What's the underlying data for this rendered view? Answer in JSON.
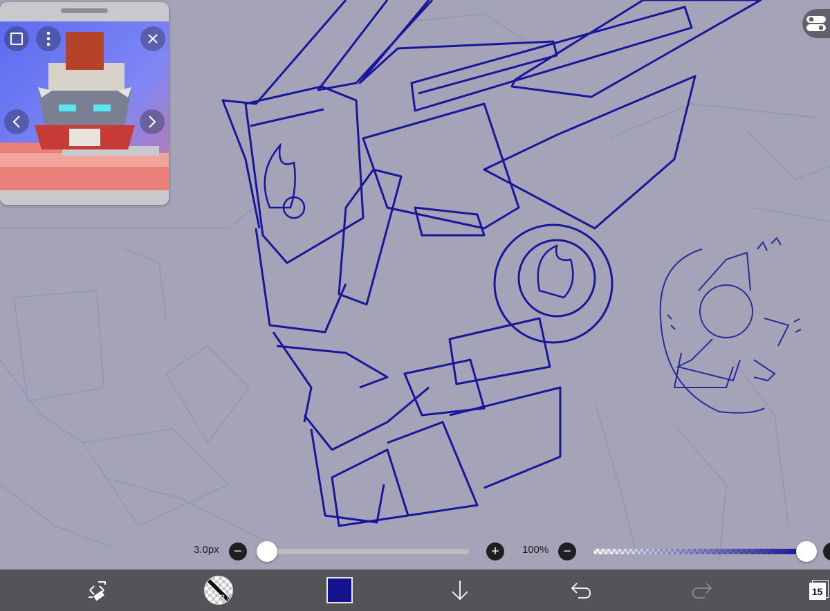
{
  "brush": {
    "size_label": "3.0px",
    "size_fraction": 0.0,
    "badge": "3.0"
  },
  "opacity": {
    "label": "100%",
    "fraction": 1.0
  },
  "toolbar": {
    "layer_count": "15"
  },
  "colors": {
    "canvas_bg": "#a4a3b7",
    "ink": "#18169a",
    "current_color": "#13138f",
    "toolbar_bg": "#545357",
    "slider_track": "#bdbdbd"
  },
  "icons": [
    "transform-eraser-icon",
    "brush-icon",
    "download-arrow-icon",
    "undo-icon",
    "redo-icon",
    "layers-icon",
    "settings-toggle-icon",
    "close-icon",
    "more-icon",
    "square-icon",
    "chevron-left-icon",
    "chevron-right-icon"
  ]
}
